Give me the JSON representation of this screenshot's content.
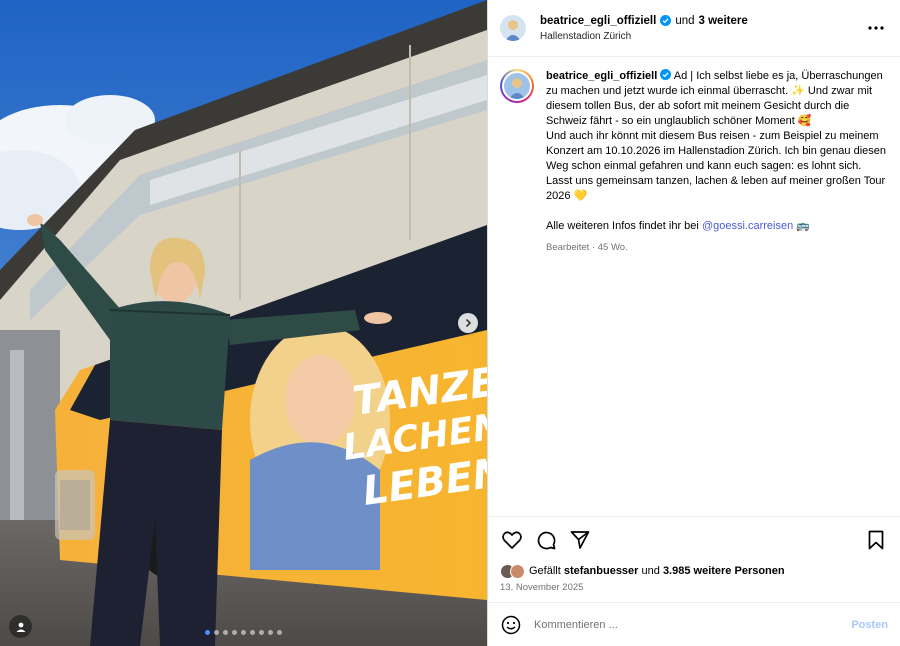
{
  "post": {
    "author": "beatrice_egli_offiziell",
    "collaborators_connector": "und",
    "collaborators_count": "3 weitere",
    "location": "Hallenstadion Zürich",
    "verified": true
  },
  "caption": {
    "username": "beatrice_egli_offiziell",
    "intro": "Ad | Ich selbst liebe es ja, Überraschungen zu machen und jetzt wurde ich einmal überrascht. ✨ Und zwar mit diesem tollen Bus, der ab sofort mit meinem Gesicht durch die Schweiz fährt - so ein unglaublich schöner Moment 🥰",
    "paragraph2": "Und auch ihr könnt mit diesem Bus reisen - zum Beispiel zu meinem Konzert am 10.10.2026 im Hallenstadion Zürich. Ich bin genau diesen Weg schon einmal gefahren und kann euch sagen: es lohnt sich. Lasst uns gemeinsam tanzen, lachen & leben auf meiner großen Tour 2026 💛",
    "infos_prefix": "Alle weiteren Infos findet ihr bei",
    "mention": "@goessi.carreisen",
    "infos_suffix": "🚌",
    "edited": "Bearbeitet · 45 Wo."
  },
  "media": {
    "bus_text_line1": "TANZEN",
    "bus_text_line2": "LACHEN",
    "bus_text_line3": "LEBEN",
    "carousel_total": 9,
    "carousel_active_index": 1
  },
  "likes": {
    "prefix": "Gefällt",
    "user": "stefanbuesser",
    "connector": "und",
    "others": "3.985 weitere Personen"
  },
  "date": "13. November 2025",
  "comment": {
    "placeholder": "Kommentieren ...",
    "post_label": "Posten"
  },
  "icons": {
    "more": "more-options-icon",
    "like": "heart-icon",
    "comment": "comment-icon",
    "share": "share-icon",
    "save": "bookmark-icon",
    "emoji": "emoji-icon",
    "tag": "user-tag-icon",
    "next": "chevron-right-icon",
    "verified": "verified-badge-icon"
  },
  "colors": {
    "mention": "#4a5bd9",
    "verified": "#0095f6",
    "post_button": "#a8c7fa",
    "carousel_active": "#4a90ff"
  }
}
